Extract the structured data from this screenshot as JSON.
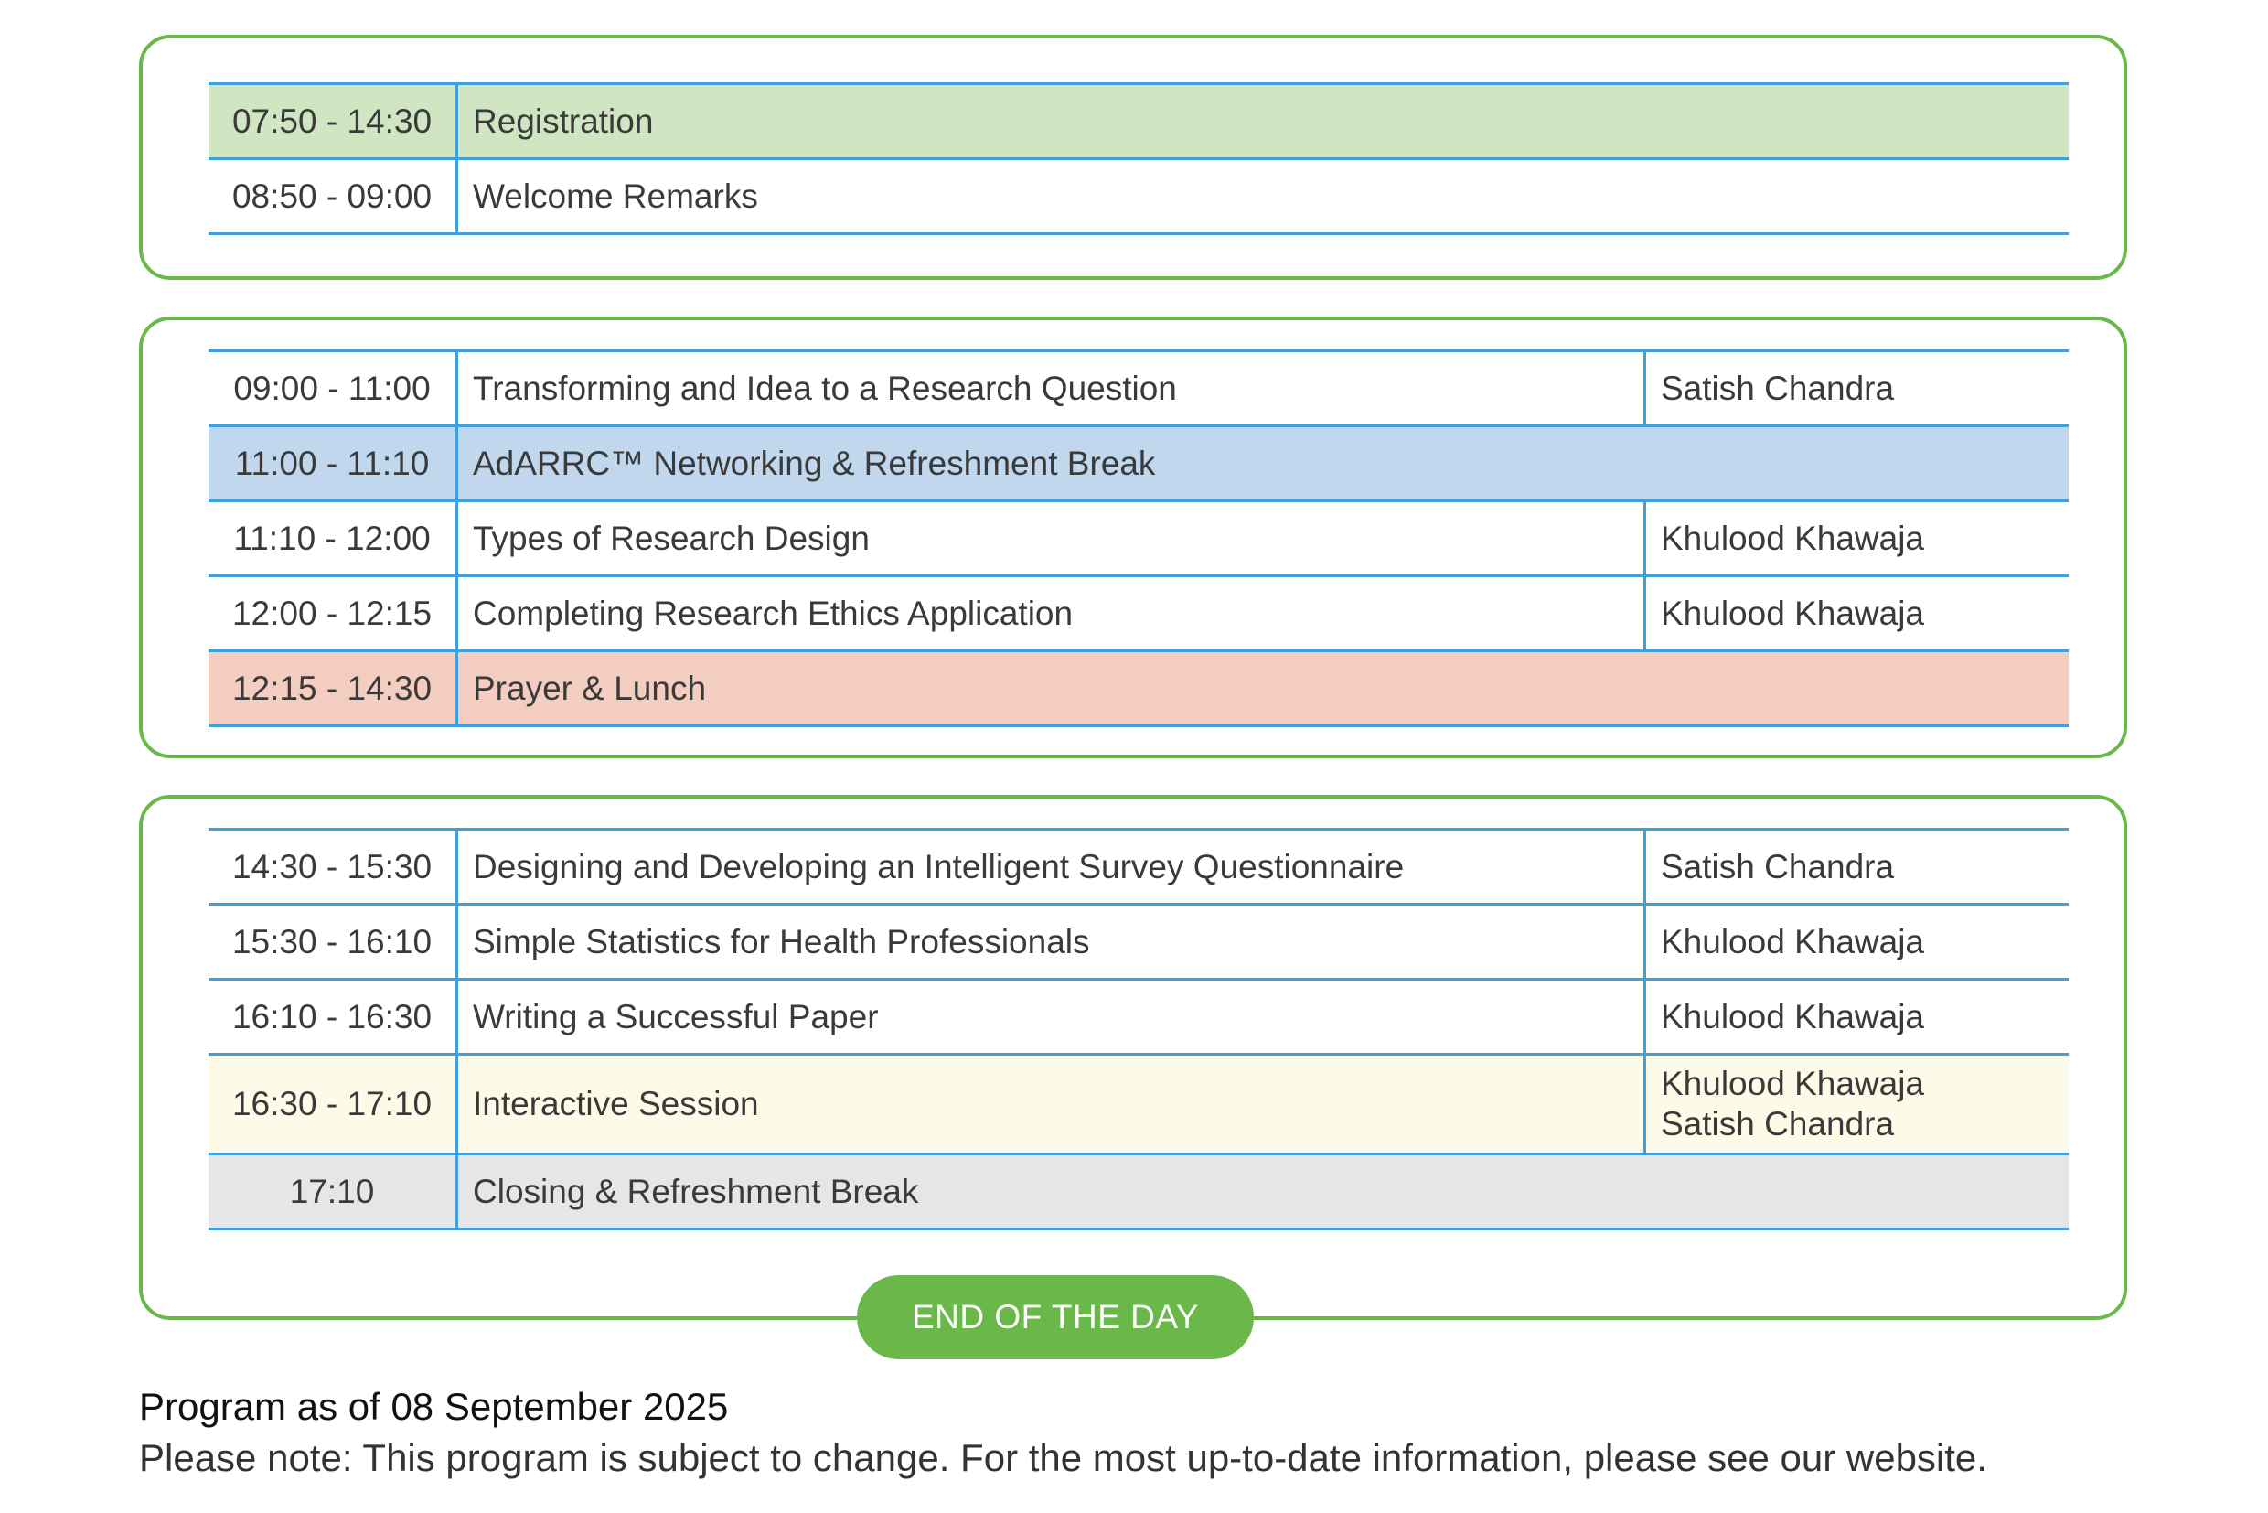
{
  "blocks": [
    {
      "rows": [
        {
          "time": "07:50 - 14:30",
          "title": "Registration",
          "style": "green"
        },
        {
          "time": "08:50 - 09:00",
          "title": "Welcome Remarks",
          "style": "plain"
        }
      ]
    },
    {
      "rows": [
        {
          "time": "09:00 - 11:00",
          "title": "Transforming and Idea to a Research Question",
          "speaker": "Satish Chandra",
          "style": "plain"
        },
        {
          "time": "11:00 - 11:10",
          "title": "AdARRC™ Networking & Refreshment Break",
          "style": "blue"
        },
        {
          "time": "11:10 - 12:00",
          "title": "Types of Research Design",
          "speaker": "Khulood Khawaja",
          "style": "plain"
        },
        {
          "time": "12:00 - 12:15",
          "title": "Completing Research Ethics Application",
          "speaker": "Khulood Khawaja",
          "style": "plain"
        },
        {
          "time": "12:15 - 14:30",
          "title": "Prayer & Lunch",
          "style": "salmon"
        }
      ]
    },
    {
      "rows": [
        {
          "time": "14:30 - 15:30",
          "title": "Designing and Developing an Intelligent Survey Questionnaire",
          "speaker": "Satish Chandra",
          "style": "plain"
        },
        {
          "time": "15:30 - 16:10",
          "title": "Simple Statistics for Health Professionals",
          "speaker": "Khulood Khawaja",
          "style": "plain"
        },
        {
          "time": "16:10 - 16:30",
          "title": "Writing a Successful Paper",
          "speaker": "Khulood Khawaja",
          "style": "plain"
        },
        {
          "time": "16:30 - 17:10",
          "title": "Interactive Session",
          "speakers": [
            "Khulood Khawaja",
            "Satish Chandra"
          ],
          "style": "yellow"
        },
        {
          "time": "17:10",
          "title": "Closing & Refreshment Break",
          "style": "gray"
        }
      ]
    }
  ],
  "end_label": "END OF THE DAY",
  "program_date": "Program as of 08 September 2025",
  "disclaimer": "Please note: This program is subject to change. For the most up-to-date information, please see our website.",
  "colors": {
    "accent_green": "#6ab74a",
    "rule_blue": "#3fa0dc",
    "row_green": "#d0e5c1",
    "row_blue": "#c1d7ee",
    "row_salmon": "#f3cdc0",
    "row_yellow": "#fdfbe8",
    "row_gray": "#e5e6e8"
  }
}
